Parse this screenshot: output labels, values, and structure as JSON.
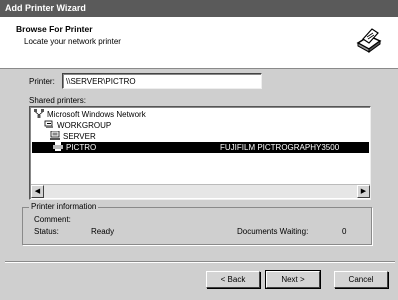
{
  "window": {
    "title": "Add Printer Wizard"
  },
  "header": {
    "title": "Browse For Printer",
    "subtitle": "Locate your network printer"
  },
  "printer_field": {
    "label": "Printer:",
    "value": "\\\\SERVER\\PICTRO"
  },
  "shared": {
    "label": "Shared printers:",
    "items": [
      {
        "label": "Microsoft Windows Network",
        "detail": ""
      },
      {
        "label": "WORKGROUP",
        "detail": ""
      },
      {
        "label": "SERVER",
        "detail": ""
      },
      {
        "label": "PICTRO",
        "detail": "FUJIFILM PICTROGRAPHY3500"
      }
    ],
    "selected_index": 3
  },
  "info": {
    "legend": "Printer information",
    "comment_label": "Comment:",
    "comment_value": "",
    "status_label": "Status:",
    "status_value": "Ready",
    "waiting_label": "Documents Waiting:",
    "waiting_value": "0"
  },
  "buttons": {
    "back": "< Back",
    "next": "Next >",
    "cancel": "Cancel"
  },
  "icons": {
    "header": "printer-icon",
    "network": "network-icon",
    "workgroup": "workgroup-icon",
    "server": "computer-icon",
    "printer": "printer-icon",
    "scroll_left": "arrow-left-icon",
    "scroll_right": "arrow-right-icon"
  }
}
